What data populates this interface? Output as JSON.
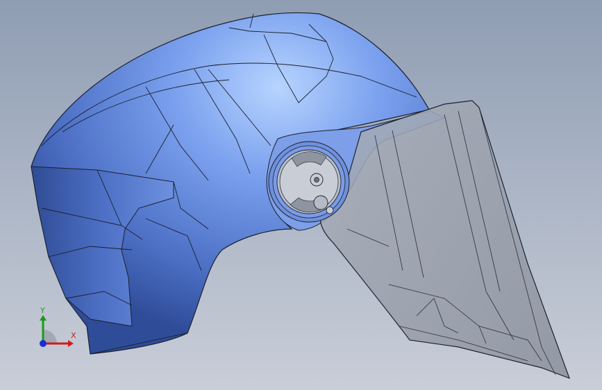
{
  "viewport": {
    "background_top": "#8f9db3",
    "background_bottom": "#c9ced8"
  },
  "model": {
    "shell_color": "#5f84d8",
    "visor_color": "#9aa0ab",
    "edge_color": "#1a1f2b"
  },
  "triad": {
    "x_label": "X",
    "y_label": "Y",
    "x_color": "#d21a1a",
    "y_color": "#1a9a1a",
    "z_color": "#1a2fd0"
  }
}
